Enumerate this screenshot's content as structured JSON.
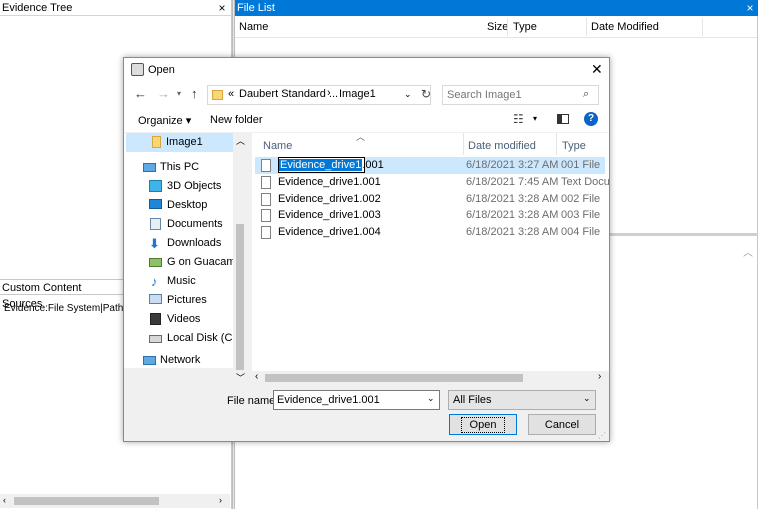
{
  "left_pane": {
    "title": "Evidence Tree",
    "close": "×",
    "lower_title": "Custom Content Sources",
    "lower_item": "Evidence:File System|Path|File"
  },
  "file_list": {
    "title": "File List",
    "close": "×",
    "columns": [
      "Name",
      "Size",
      "Type",
      "Date Modified"
    ],
    "colors": {
      "title_bg": "#0078d7"
    }
  },
  "dialog": {
    "title": "Open",
    "close": "✕",
    "address": {
      "chevrons": "«",
      "crumbs": [
        "Daubert Standard ...",
        "Image1"
      ],
      "separator": "›"
    },
    "search_placeholder": "Search Image1",
    "toolbar": {
      "organize": "Organize ▾",
      "new_folder": "New folder"
    },
    "nav": [
      {
        "label": "Image1",
        "icon": "folder-icon"
      },
      {
        "label": "This PC",
        "icon": "computer-icon"
      },
      {
        "label": "3D Objects",
        "icon": "cube-icon"
      },
      {
        "label": "Desktop",
        "icon": "desktop-icon"
      },
      {
        "label": "Documents",
        "icon": "documents-icon"
      },
      {
        "label": "Downloads",
        "icon": "download-icon"
      },
      {
        "label": "G on Guacamole",
        "icon": "network-drive-icon"
      },
      {
        "label": "Music",
        "icon": "music-icon"
      },
      {
        "label": "Pictures",
        "icon": "pictures-icon"
      },
      {
        "label": "Videos",
        "icon": "videos-icon"
      },
      {
        "label": "Local Disk (C:)",
        "icon": "disk-icon"
      },
      {
        "label": "Network",
        "icon": "network-icon"
      }
    ],
    "columns": {
      "name": "Name",
      "date": "Date modified",
      "type": "Type"
    },
    "files": [
      {
        "name": "Evidence_drive1",
        "ext": ".001",
        "date": "6/18/2021 3:27 AM",
        "type": "001 File"
      },
      {
        "name": "Evidence_drive1.001",
        "date": "6/18/2021 7:45 AM",
        "type": "Text Docum"
      },
      {
        "name": "Evidence_drive1.002",
        "date": "6/18/2021 3:28 AM",
        "type": "002 File"
      },
      {
        "name": "Evidence_drive1.003",
        "date": "6/18/2021 3:28 AM",
        "type": "003 File"
      },
      {
        "name": "Evidence_drive1.004",
        "date": "6/18/2021 3:28 AM",
        "type": "004 File"
      }
    ],
    "filename_label": "File name:",
    "filename_value": "Evidence_drive1.001",
    "filter_value": "All Files",
    "open_button": "Open",
    "cancel_button": "Cancel",
    "colors": {
      "selection": "#cce8ff",
      "selection_border": "#99d1ff",
      "accent": "#0078d7"
    }
  }
}
